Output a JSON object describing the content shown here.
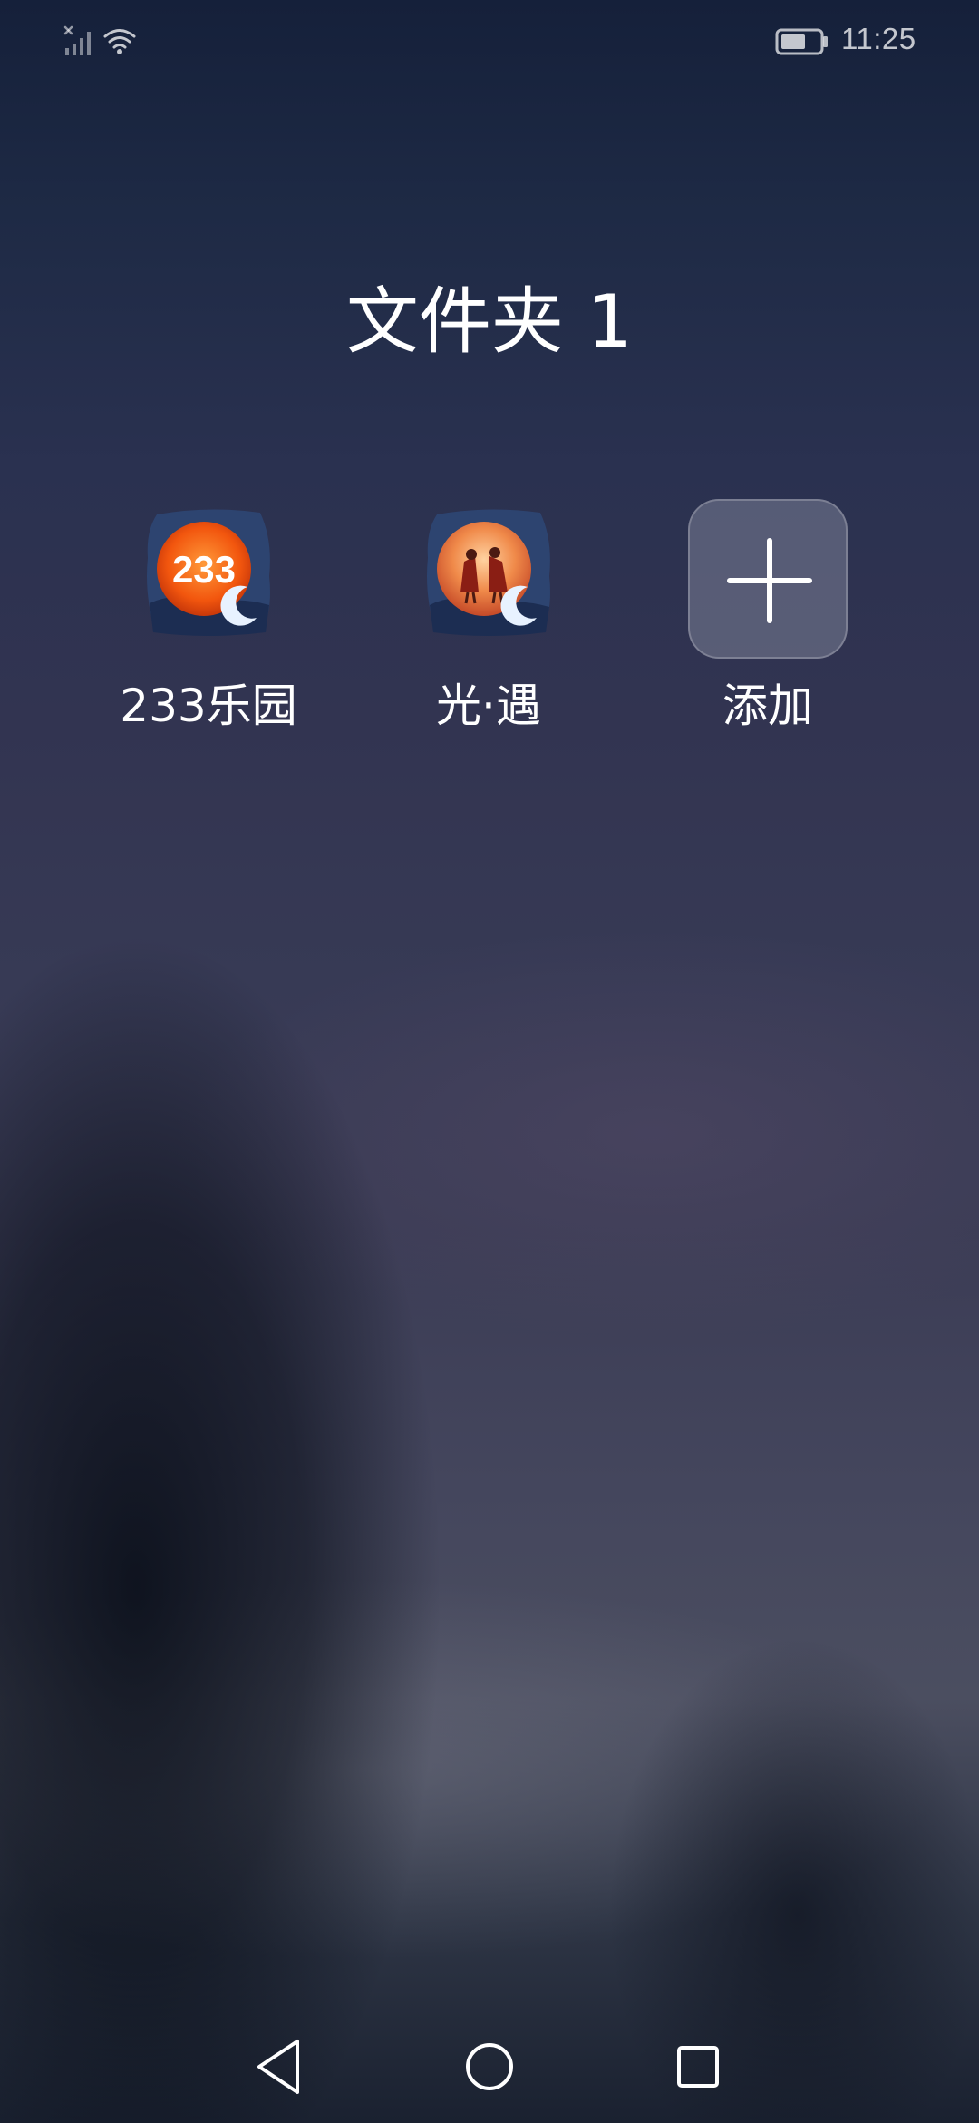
{
  "status_bar": {
    "time": "11:25",
    "signal_icon": "signal-no-sim-icon",
    "wifi_icon": "wifi-icon",
    "battery_icon": "battery-icon"
  },
  "folder": {
    "title": "文件夹 1"
  },
  "apps": [
    {
      "label": "233乐园",
      "icon": "233-park-app-icon",
      "badge_text": "233"
    },
    {
      "label": "光·遇",
      "icon": "sky-game-app-icon"
    },
    {
      "label": "添加",
      "icon": "plus-icon"
    }
  ],
  "nav_bar": {
    "back_icon": "back-triangle-icon",
    "home_icon": "home-circle-icon",
    "recent_icon": "recent-apps-square-icon"
  }
}
